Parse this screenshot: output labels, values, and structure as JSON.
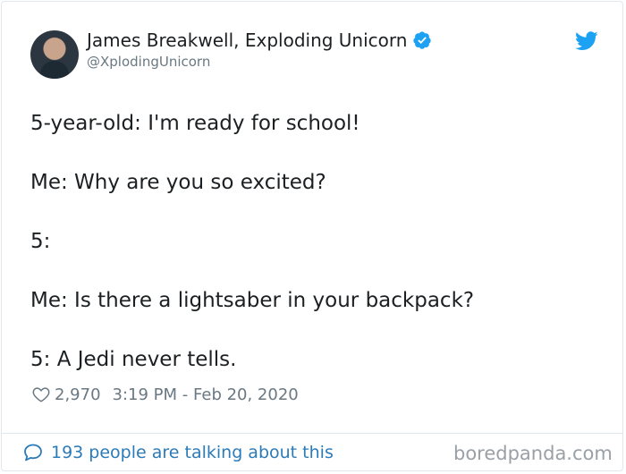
{
  "user": {
    "display_name": "James Breakwell, Exploding Unicorn",
    "handle": "@XplodingUnicorn",
    "verified": true
  },
  "tweet": {
    "lines": [
      "5-year-old: I'm ready for school!",
      "",
      "Me: Why are you so excited?",
      "",
      "5:",
      "",
      "Me: Is there a lightsaber in your backpack?",
      "",
      "5: A Jedi never tells."
    ]
  },
  "meta": {
    "likes": "2,970",
    "timestamp": "3:19 PM - Feb 20, 2020"
  },
  "footer": {
    "talking": "193 people are talking about this"
  },
  "watermark": "boredpanda.com",
  "colors": {
    "text": "#1c2022",
    "muted": "#697882",
    "link": "#2b7bb9",
    "twitter_blue": "#1da1f2",
    "verified": "#1da1f2"
  },
  "icons": {
    "verified": "verified-badge-icon",
    "brand": "twitter-bird-icon",
    "like": "heart-icon",
    "reply": "speech-bubble-icon"
  }
}
